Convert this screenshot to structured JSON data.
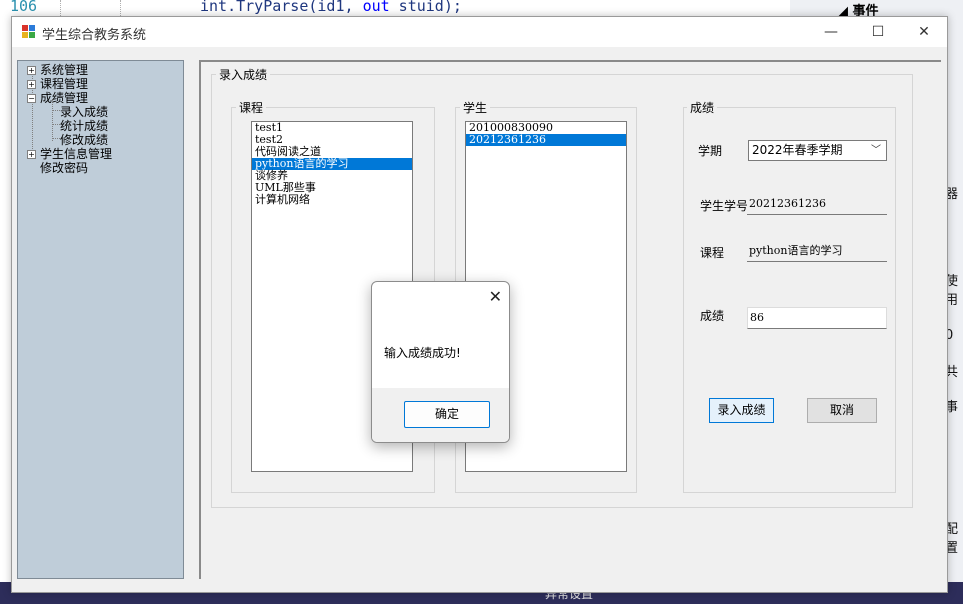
{
  "ide": {
    "line_number": "106",
    "code_method": "int.TryParse(id1, ",
    "code_kw": "out",
    "code_rest": " stuid);",
    "right_panel_title": "事件",
    "side_fragments": [
      "器",
      "使用",
      "0",
      "共",
      "事",
      "配置"
    ],
    "bottom_text": "异常设置"
  },
  "window": {
    "title": "学生综合教务系统",
    "minimize": "—",
    "maximize": "☐",
    "close": "✕"
  },
  "tree": {
    "items": [
      {
        "label": "系统管理",
        "expander": "+"
      },
      {
        "label": "课程管理",
        "expander": "+"
      },
      {
        "label": "成绩管理",
        "expander": "−"
      },
      {
        "label": "录入成绩"
      },
      {
        "label": "统计成绩"
      },
      {
        "label": "修改成绩"
      },
      {
        "label": "学生信息管理",
        "expander": "+"
      },
      {
        "label": "修改密码"
      }
    ]
  },
  "form": {
    "group_title": "录入成绩",
    "course_group": "课程",
    "student_group": "学生",
    "score_group": "成绩",
    "courses": [
      "test1",
      "test2",
      "代码阅读之道",
      "python语言的学习",
      "谈修养",
      "UML那些事",
      "计算机网络"
    ],
    "selected_course_index": 3,
    "students": [
      "201000830090",
      "20212361236"
    ],
    "selected_student_index": 1,
    "term_label": "学期",
    "term_value": "2022年春季学期",
    "student_id_label": "学生学号",
    "student_id_value": "20212361236",
    "course_label": "课程",
    "course_value": "python语言的学习",
    "score_label": "成绩",
    "score_value": "86",
    "submit_label": "录入成绩",
    "cancel_label": "取消"
  },
  "dialog": {
    "close": "✕",
    "message": "输入成绩成功!",
    "ok_label": "确定"
  }
}
